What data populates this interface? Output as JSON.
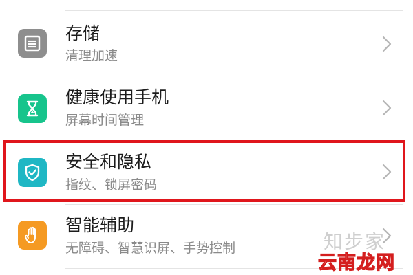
{
  "settings": {
    "items": [
      {
        "title": "存储",
        "subtitle": "清理加速",
        "icon": "storage-icon",
        "icon_color": "#8e8e8e"
      },
      {
        "title": "健康使用手机",
        "subtitle": "屏幕时间管理",
        "icon": "hourglass-icon",
        "icon_color": "#17c48c"
      },
      {
        "title": "安全和隐私",
        "subtitle": "指纹、锁屏密码",
        "icon": "shield-check-icon",
        "icon_color": "#1fb7c4",
        "highlighted": true
      },
      {
        "title": "智能辅助",
        "subtitle": "无障碍、智慧识屏、手势控制",
        "icon": "hand-icon",
        "icon_color": "#f59a23"
      }
    ]
  },
  "highlight_color": "#e0161c",
  "watermark": {
    "line1": "知步家",
    "line2": "云南龙网"
  }
}
